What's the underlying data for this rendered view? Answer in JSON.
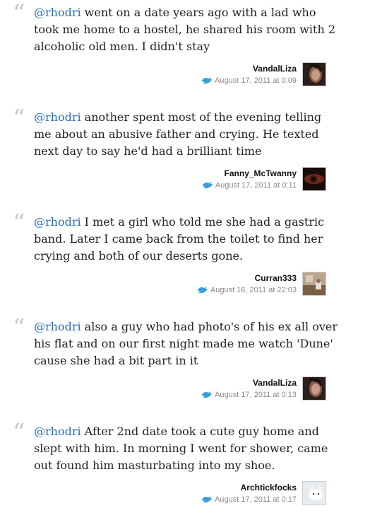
{
  "tweets": [
    {
      "mention": "@rhodri",
      "text": " went on a date years ago with a lad who took me home to a hostel, he shared his room with 2 alcoholic old men. I didn't stay",
      "author": "VandalLiza",
      "timestamp": "August 17, 2011 at 0:09",
      "avatar_icon": "woman-portrait"
    },
    {
      "mention": "@rhodri",
      "text": " another spent most of the evening telling me about an abusive father and crying. He texted next day to say he'd had a brilliant time",
      "author": "Fanny_McTwanny",
      "timestamp": "August 17, 2011 at 0:11",
      "avatar_icon": "eye-closeup"
    },
    {
      "mention": "@rhodri",
      "text": " I met a girl who told me she had a gastric band. Later I came back from the toilet to find her crying and both of our deserts gone.",
      "author": "Curran333",
      "timestamp": "August 16, 2011 at 22:03",
      "avatar_icon": "room-photo"
    },
    {
      "mention": "@rhodri",
      "text": " also a guy who had photo's of his ex all over his flat and on our first night made me watch 'Dune' cause she had a bit part in it",
      "author": "VandalLiza",
      "timestamp": "August 17, 2011 at 0:13",
      "avatar_icon": "woman-portrait"
    },
    {
      "mention": "@rhodri",
      "text": " After 2nd date took a cute guy home and slept with him. In morning I went for shower, came out found him masturbating into my shoe.",
      "author": "Archtickfocks",
      "timestamp": "August 17, 2011 at 0:17",
      "avatar_icon": "white-fox"
    }
  ],
  "colors": {
    "mention": "#2a6db6",
    "quote_mark": "#c8c8c8",
    "timestamp": "#888888",
    "bird": "#3b9fd8"
  }
}
